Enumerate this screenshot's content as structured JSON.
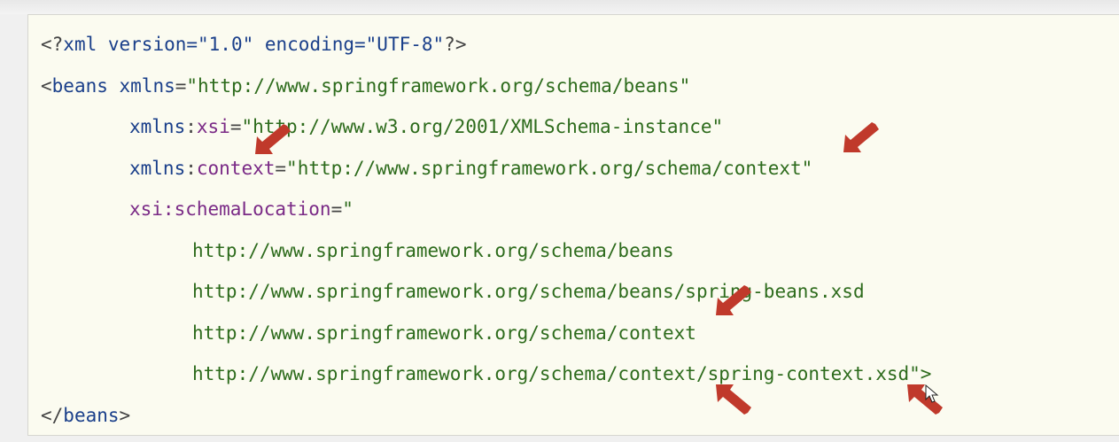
{
  "xml_declaration": {
    "open": "<?",
    "name": "xml",
    "attrs": " version=\"1.0\" encoding=\"UTF-8\"",
    "close": "?>"
  },
  "beans_open": {
    "lt": "<",
    "tag": "beans",
    "attr_name": " xmlns",
    "eq": "=",
    "value": "\"http://www.springframework.org/schema/beans\""
  },
  "xmlns_xsi": {
    "prefix": "xmlns",
    "colon": ":",
    "ns": "xsi",
    "eq": "=",
    "value": "\"http://www.w3.org/2001/XMLSchema-instance\""
  },
  "xmlns_context": {
    "prefix": "xmlns",
    "colon": ":",
    "ns": "context",
    "eq": "=",
    "value": "\"http://www.springframework.org/schema/context\""
  },
  "schema_location": {
    "name": "xsi:schemaLocation",
    "eq": "=",
    "quote": "\""
  },
  "schema_urls": [
    "http://www.springframework.org/schema/beans",
    "http://www.springframework.org/schema/beans/spring-beans.xsd",
    "http://www.springframework.org/schema/context",
    "http://www.springframework.org/schema/context/spring-context.xsd"
  ],
  "schema_close": "\">",
  "beans_close": {
    "lt": "</",
    "tag": "beans",
    "gt": ">"
  },
  "annotations": {
    "arrow_color": "#c0392b",
    "arrow_icon": "red-arrow-icon",
    "cursor_icon": "mouse-pointer-icon"
  },
  "colors": {
    "panel_background": "#fbfbf0",
    "tag": "#1a3f8a",
    "namespace": "#7a2a86",
    "string": "#2d6b1c"
  }
}
